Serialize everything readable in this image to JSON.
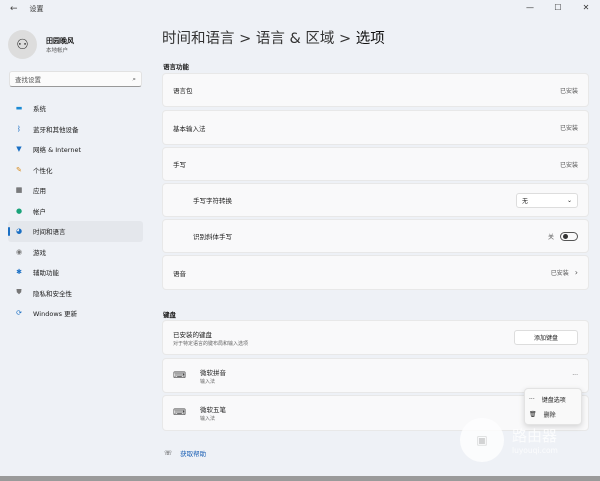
{
  "window": {
    "title": "设置",
    "back": "←",
    "controls": [
      "—",
      "☐",
      "✕"
    ]
  },
  "profile": {
    "name": "田园晚风",
    "type": "本地帐户"
  },
  "search": {
    "placeholder": "查找设置",
    "icon": "⌕"
  },
  "nav": [
    {
      "label": "系统",
      "icon": "▬",
      "color": "#1a8ad4"
    },
    {
      "label": "蓝牙和其他设备",
      "icon": "ᛒ",
      "color": "#1a6fc4"
    },
    {
      "label": "网络 & Internet",
      "icon": "▼",
      "color": "#1a6fc4"
    },
    {
      "label": "个性化",
      "icon": "✎",
      "color": "#d88a1a"
    },
    {
      "label": "应用",
      "icon": "▦",
      "color": "#333"
    },
    {
      "label": "帐户",
      "icon": "●",
      "color": "#1aa37a"
    },
    {
      "label": "时间和语言",
      "icon": "◕",
      "color": "#1a6fc4",
      "selected": true
    },
    {
      "label": "游戏",
      "icon": "◉",
      "color": "#777"
    },
    {
      "label": "辅助功能",
      "icon": "✱",
      "color": "#1a6fc4"
    },
    {
      "label": "隐私和安全性",
      "icon": "⛊",
      "color": "#777"
    },
    {
      "label": "Windows 更新",
      "icon": "⟳",
      "color": "#1a6fc4"
    }
  ],
  "breadcrumb": {
    "p1": "时间和语言",
    "p2": "语言 & 区域",
    "current": "选项",
    "sep": ">"
  },
  "language": {
    "title": "语言功能",
    "pack": {
      "label": "语言包",
      "status": "已安装"
    },
    "basic": {
      "label": "基本输入法",
      "status": "已安装"
    },
    "hw": {
      "label": "手写",
      "status": "已安装"
    },
    "hwconv": {
      "label": "手写字符转换",
      "value": "无"
    },
    "italic": {
      "label": "识别斜体手写",
      "state": "关"
    },
    "speech": {
      "label": "语音",
      "status": "已安装"
    }
  },
  "keyboard": {
    "title": "键盘",
    "installed": "已安装的键盘",
    "installed_desc": "对于特定语言的键布局和输入选项",
    "add": "添加键盘",
    "items": [
      {
        "name": "微软拼音",
        "type": "输入法"
      },
      {
        "name": "微软五笔",
        "type": "输入法"
      }
    ],
    "more": "···"
  },
  "menu": {
    "options": "键盘选项",
    "delete": "删除"
  },
  "help": "获取帮助",
  "watermark": {
    "title": "路由器",
    "url": "luyouqi.com"
  }
}
